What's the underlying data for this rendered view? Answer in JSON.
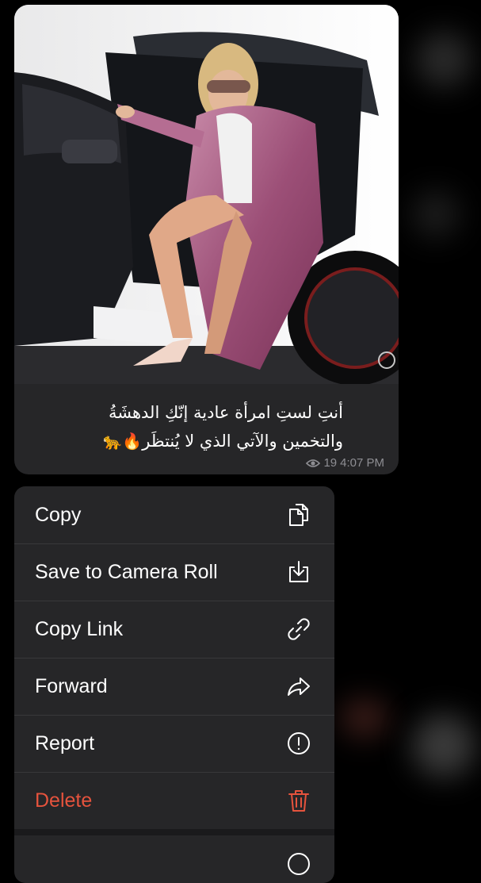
{
  "message": {
    "caption": "أنتِ لستِ امرأة عادية إنّكِ الدهشَةُ والتخمين والآتي الذي لا يُنتظَر🐆🔥",
    "caption_line1": "أنتِ لستِ امرأة عادية إنّكِ الدهشَةُ",
    "caption_line2": "والتخمين والآتي الذي لا يُنتظَر",
    "caption_emoji": "🔥🐆",
    "views": "19",
    "time": "4:07 PM"
  },
  "menu": {
    "items": [
      {
        "label": "Copy",
        "icon": "copy-icon"
      },
      {
        "label": "Save to Camera Roll",
        "icon": "save-download-icon"
      },
      {
        "label": "Copy Link",
        "icon": "link-icon"
      },
      {
        "label": "Forward",
        "icon": "forward-arrow-icon"
      },
      {
        "label": "Report",
        "icon": "exclamation-circle-icon"
      },
      {
        "label": "Delete",
        "icon": "trash-icon",
        "destructive": true
      }
    ]
  },
  "colors": {
    "background": "#000000",
    "bubble": "#262628",
    "menu": "#262628",
    "text": "#ffffff",
    "meta": "#8e8e93",
    "destructive": "#e5533d",
    "separator": "#38383a"
  }
}
